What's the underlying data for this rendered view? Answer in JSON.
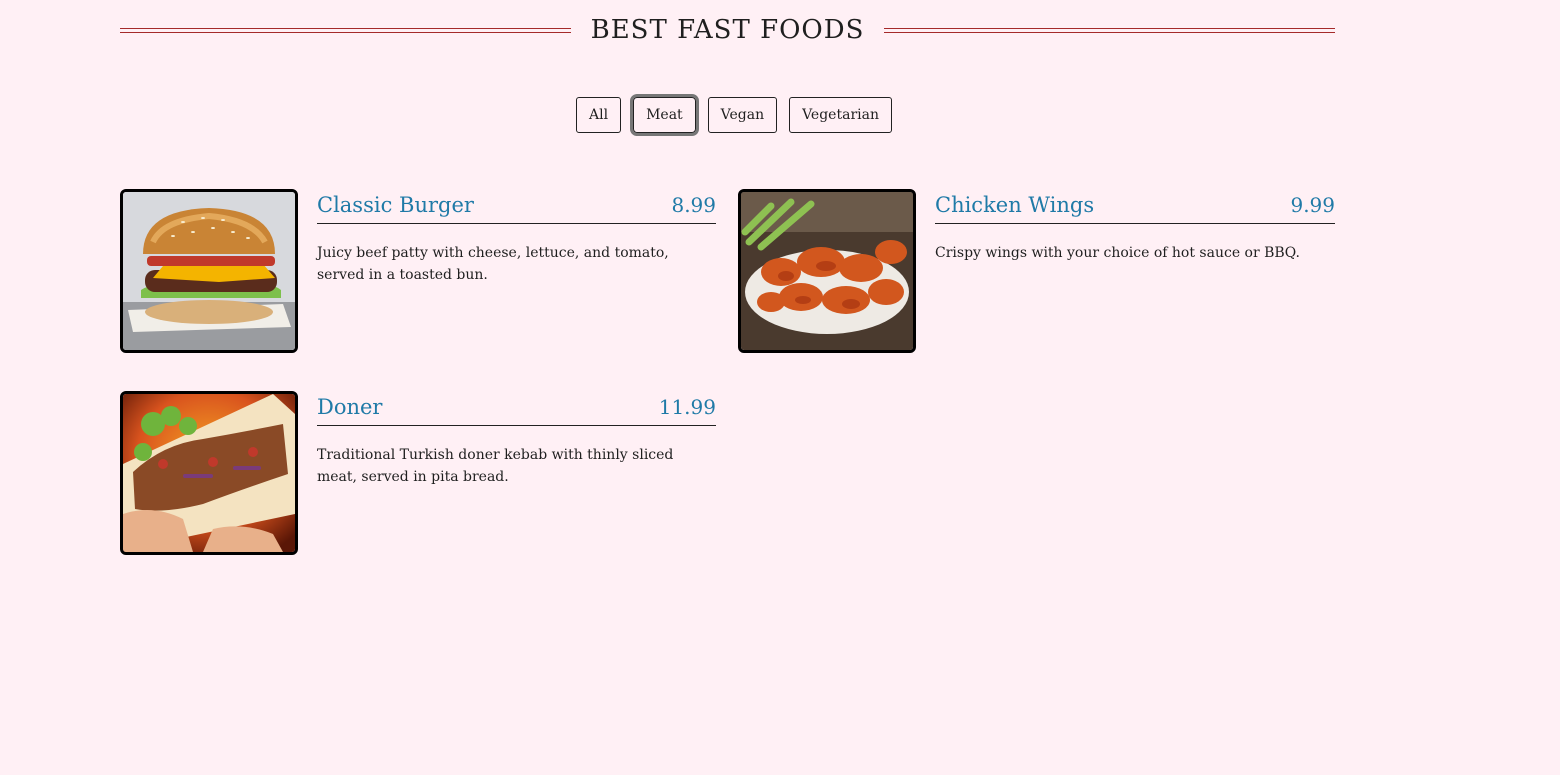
{
  "header": {
    "title": "BEST FAST FOODS"
  },
  "filters": {
    "buttons": [
      "All",
      "Meat",
      "Vegan",
      "Vegetarian"
    ],
    "active": "Meat"
  },
  "menu": {
    "items": [
      {
        "name": "Classic Burger",
        "price": "8.99",
        "description": "Juicy beef patty with cheese, lettuce, and tomato, served in a toasted bun.",
        "image": "burger-photo"
      },
      {
        "name": "Chicken Wings",
        "price": "9.99",
        "description": "Crispy wings with your choice of hot sauce or BBQ.",
        "image": "chicken-wings-photo"
      },
      {
        "name": "Doner",
        "price": "11.99",
        "description": "Traditional Turkish doner kebab with thinly sliced meat, served in pita bread.",
        "image": "doner-photo"
      }
    ]
  },
  "colors": {
    "background": "#fff0f5",
    "accent": "#1f7aa7",
    "title_rule": "#a52a2a"
  }
}
